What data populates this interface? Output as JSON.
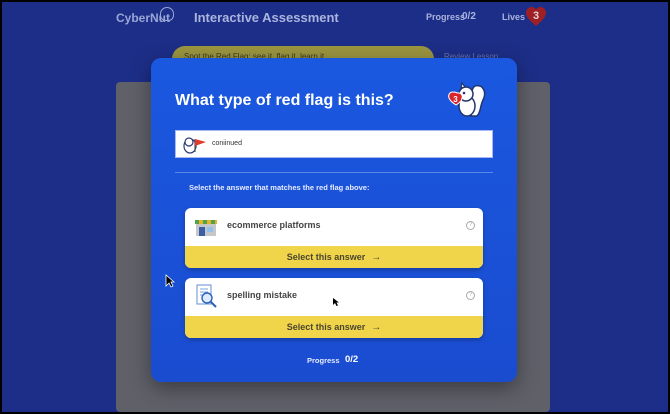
{
  "header": {
    "brand": "CyberNut",
    "title": "Interactive Assessment",
    "progress_label": "Progress",
    "progress_value": "0/2",
    "lives_label": "Lives",
    "lives_value": "3"
  },
  "background": {
    "banner_text": "Spot the Red Flag: see it, flag it, learn it",
    "review_text": "Review Lesson"
  },
  "modal": {
    "title": "What type of red flag is this?",
    "mascot_lives": "3",
    "flag_text": "coniinued",
    "instruction": "Select the answer that matches the red flag above:",
    "answers": [
      {
        "label": "ecommerce platforms",
        "button": "Select this answer",
        "icon": "storefront-icon",
        "help": "?"
      },
      {
        "label": "spelling mistake",
        "button": "Select this answer",
        "icon": "document-magnifier-icon",
        "help": "?"
      }
    ],
    "progress_label": "Progress",
    "progress_value": "0/2"
  },
  "colors": {
    "page_bg": "#1d2e88",
    "modal_bg": "#1a55dc",
    "button_yellow": "#f0d54a",
    "heart_red": "#d9252a"
  }
}
